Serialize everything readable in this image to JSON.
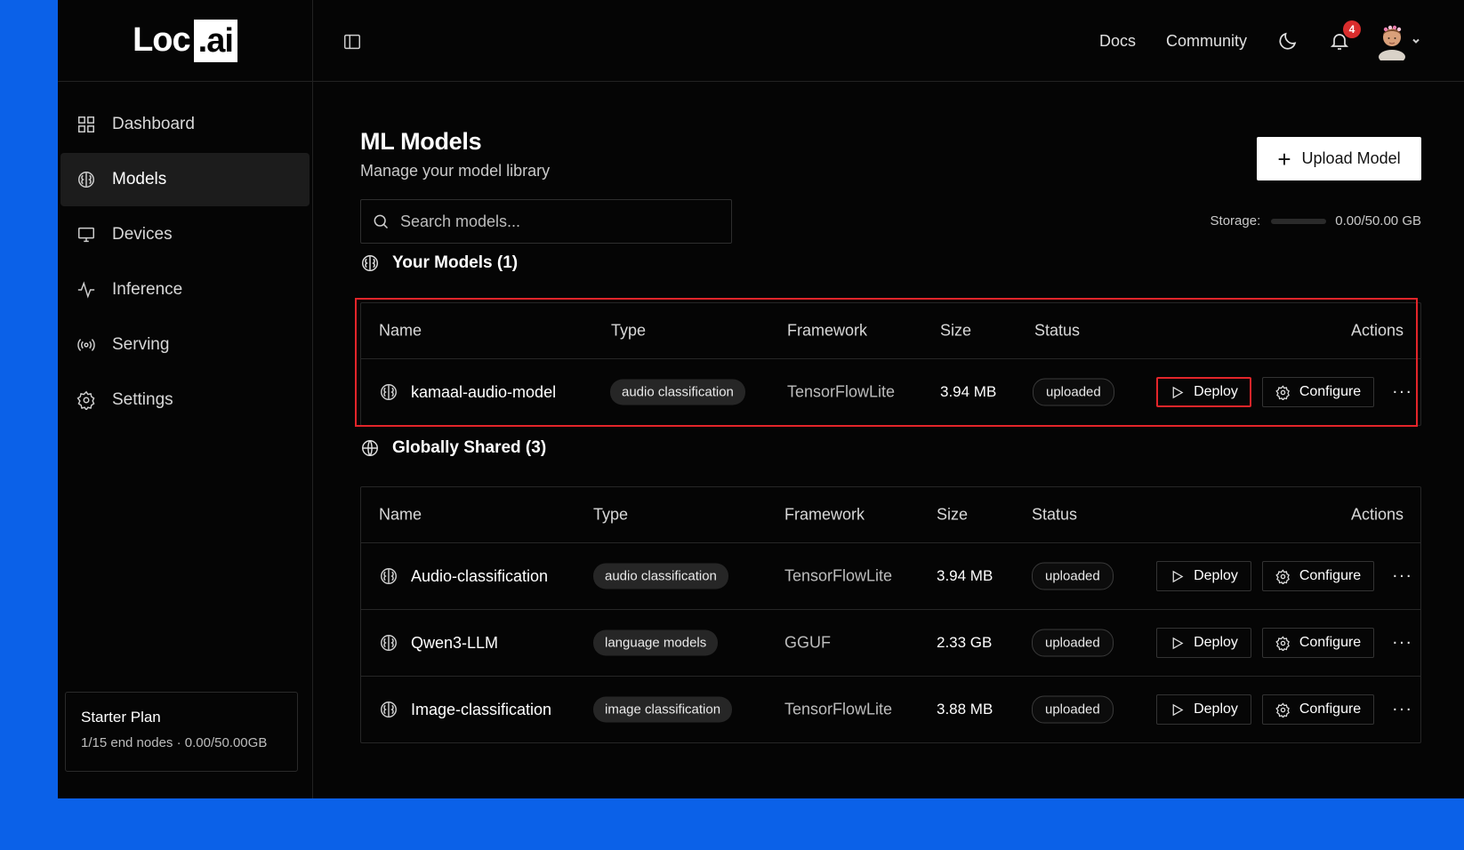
{
  "logo": {
    "text": "Loc",
    "box": ".ai"
  },
  "sidebar": {
    "items": [
      {
        "label": "Dashboard",
        "icon": "grid-icon"
      },
      {
        "label": "Models",
        "icon": "brain-icon",
        "active": true
      },
      {
        "label": "Devices",
        "icon": "monitor-icon"
      },
      {
        "label": "Inference",
        "icon": "activity-icon"
      },
      {
        "label": "Serving",
        "icon": "broadcast-icon"
      },
      {
        "label": "Settings",
        "icon": "gear-icon"
      }
    ],
    "plan": {
      "title": "Starter Plan",
      "sub": "1/15 end nodes · 0.00/50.00GB"
    }
  },
  "topbar": {
    "docs": "Docs",
    "community": "Community",
    "notifications": "4"
  },
  "page": {
    "title": "ML Models",
    "subtitle": "Manage your model library",
    "upload_label": "Upload Model",
    "search_placeholder": "Search models...",
    "storage_label": "Storage:",
    "storage_value": "0.00/50.00 GB",
    "storage_fraction": 0.0
  },
  "headers": {
    "name": "Name",
    "type": "Type",
    "framework": "Framework",
    "size": "Size",
    "status": "Status",
    "actions": "Actions"
  },
  "your_models": {
    "title": "Your Models (1)",
    "rows": [
      {
        "name": "kamaal-audio-model",
        "type": "audio classification",
        "framework": "TensorFlowLite",
        "size": "3.94 MB",
        "status": "uploaded"
      }
    ]
  },
  "shared": {
    "title": "Globally Shared (3)",
    "rows": [
      {
        "name": "Audio-classification",
        "type": "audio classification",
        "framework": "TensorFlowLite",
        "size": "3.94 MB",
        "status": "uploaded"
      },
      {
        "name": "Qwen3-LLM",
        "type": "language models",
        "framework": "GGUF",
        "size": "2.33 GB",
        "status": "uploaded"
      },
      {
        "name": "Image-classification",
        "type": "image classification",
        "framework": "TensorFlowLite",
        "size": "3.88 MB",
        "status": "uploaded"
      }
    ]
  },
  "actions": {
    "deploy": "Deploy",
    "configure": "Configure",
    "more": "···"
  },
  "colors": {
    "accent_blue": "#0b61e8",
    "highlight_red": "#e3252a",
    "background": "#050505"
  }
}
